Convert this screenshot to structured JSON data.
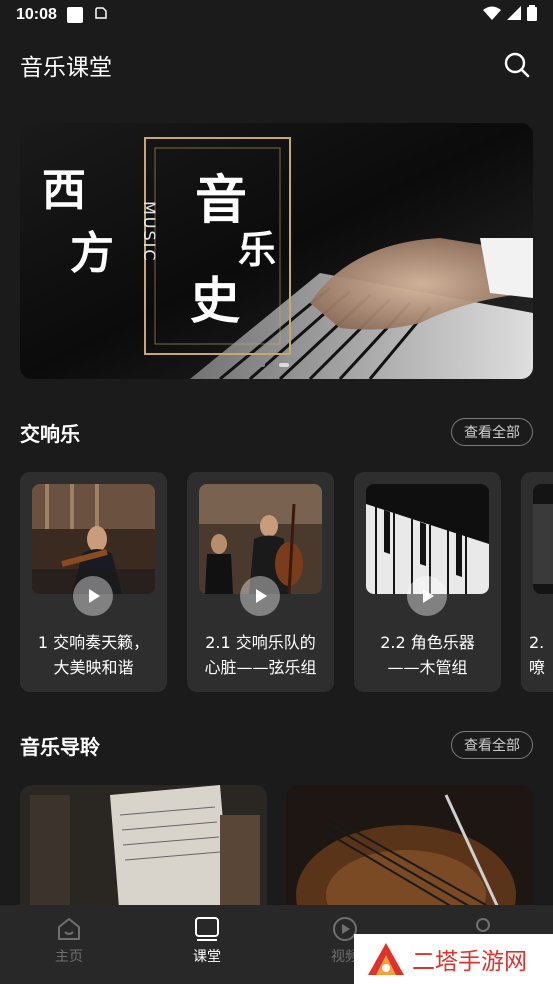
{
  "status_bar": {
    "time": "10:08"
  },
  "header": {
    "title": "音乐课堂"
  },
  "banner": {
    "text_left_1": "西",
    "text_left_2": "方",
    "text_vertical": "MUSIC",
    "text_1": "音",
    "text_2": "乐",
    "text_3": "史"
  },
  "sections": {
    "symphony": {
      "title": "交响乐",
      "view_all": "查看全部"
    },
    "guide": {
      "title": "音乐导聆",
      "view_all": "查看全部"
    }
  },
  "symphony_cards": [
    {
      "title_line1": "1 交响奏天籁，",
      "title_line2": "大美映和谐"
    },
    {
      "title_line1": "2.1 交响乐队的",
      "title_line2": "心脏——弦乐组"
    },
    {
      "title_line1": "2.2 角色乐器",
      "title_line2": "——木管组"
    },
    {
      "title_line1": "2.",
      "title_line2": "嘹"
    }
  ],
  "bottom_nav": {
    "items": [
      {
        "label": "主页",
        "icon": "home-icon",
        "active": false
      },
      {
        "label": "课堂",
        "icon": "classroom-icon",
        "active": true
      },
      {
        "label": "视频",
        "icon": "video-play-icon",
        "active": false
      },
      {
        "label": "",
        "icon": "profile-icon",
        "active": false
      }
    ]
  },
  "watermark": {
    "text": "二塔手游网"
  },
  "colors": {
    "background": "#1b1b1b",
    "card": "#2e2e2e",
    "nav": "#282828",
    "gold": "#c9a86a",
    "watermark_red": "#e0322b"
  }
}
